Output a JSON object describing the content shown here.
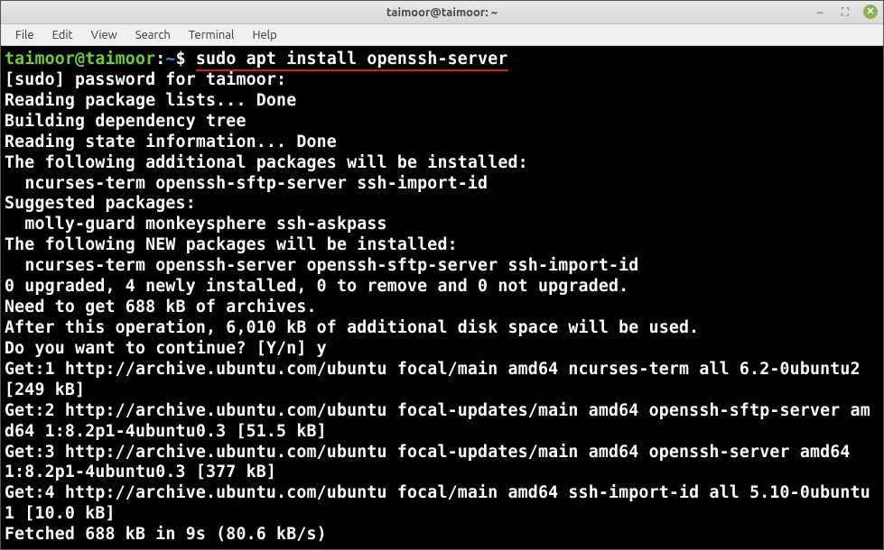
{
  "window": {
    "title": "taimoor@taimoor: ~"
  },
  "menu": {
    "file": "File",
    "edit": "Edit",
    "view": "View",
    "search": "Search",
    "terminal": "Terminal",
    "help": "Help"
  },
  "prompt": {
    "userhost": "taimoor@taimoor",
    "colon": ":",
    "path": "~",
    "symbol": "$"
  },
  "command": "sudo apt install openssh-server",
  "output": {
    "l1": "[sudo] password for taimoor:",
    "l2": "Reading package lists... Done",
    "l3": "Building dependency tree",
    "l4": "Reading state information... Done",
    "l5": "The following additional packages will be installed:",
    "l6": "  ncurses-term openssh-sftp-server ssh-import-id",
    "l7": "Suggested packages:",
    "l8": "  molly-guard monkeysphere ssh-askpass",
    "l9": "The following NEW packages will be installed:",
    "l10": "  ncurses-term openssh-server openssh-sftp-server ssh-import-id",
    "l11": "0 upgraded, 4 newly installed, 0 to remove and 0 not upgraded.",
    "l12": "Need to get 688 kB of archives.",
    "l13": "After this operation, 6,010 kB of additional disk space will be used.",
    "l14": "Do you want to continue? [Y/n] y",
    "l15": "Get:1 http://archive.ubuntu.com/ubuntu focal/main amd64 ncurses-term all 6.2-0ubuntu2 [249 kB]",
    "l16": "Get:2 http://archive.ubuntu.com/ubuntu focal-updates/main amd64 openssh-sftp-server amd64 1:8.2p1-4ubuntu0.3 [51.5 kB]",
    "l17": "Get:3 http://archive.ubuntu.com/ubuntu focal-updates/main amd64 openssh-server amd64 1:8.2p1-4ubuntu0.3 [377 kB]",
    "l18": "Get:4 http://archive.ubuntu.com/ubuntu focal/main amd64 ssh-import-id all 5.10-0ubuntu1 [10.0 kB]",
    "l19": "Fetched 688 kB in 9s (80.6 kB/s)"
  }
}
